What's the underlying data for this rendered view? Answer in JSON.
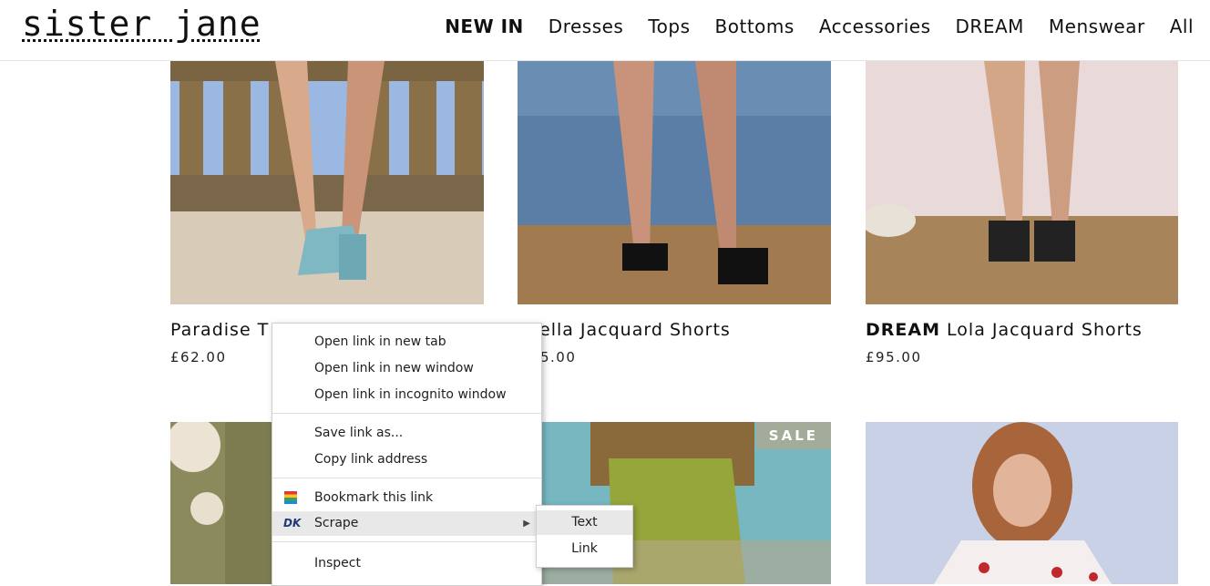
{
  "header": {
    "logo": "sister jane",
    "nav": [
      "NEW IN",
      "Dresses",
      "Tops",
      "Bottoms",
      "Accessories",
      "DREAM",
      "Menswear",
      "All"
    ]
  },
  "products": [
    {
      "name": "Paradise T",
      "price": "£62.00"
    },
    {
      "name": "Ella Jacquard Shorts",
      "price_visible": "5.00",
      "name_visible": "ella Jacquard Shorts"
    },
    {
      "brand": "DREAM",
      "name": "Lola Jacquard Shorts",
      "price": "£95.00"
    }
  ],
  "badges": {
    "sale": "SALE"
  },
  "context_menu": {
    "items": [
      "Open link in new tab",
      "Open link in new window",
      "Open link in incognito window",
      "Save link as...",
      "Copy link address",
      "Bookmark this link",
      "Scrape",
      "Inspect"
    ],
    "submenu": [
      "Text",
      "Link"
    ],
    "dk_icon_label": "DK"
  },
  "colors": {
    "sale_badge": "#a3ab9a",
    "menu_hover": "#e8e8e8"
  }
}
